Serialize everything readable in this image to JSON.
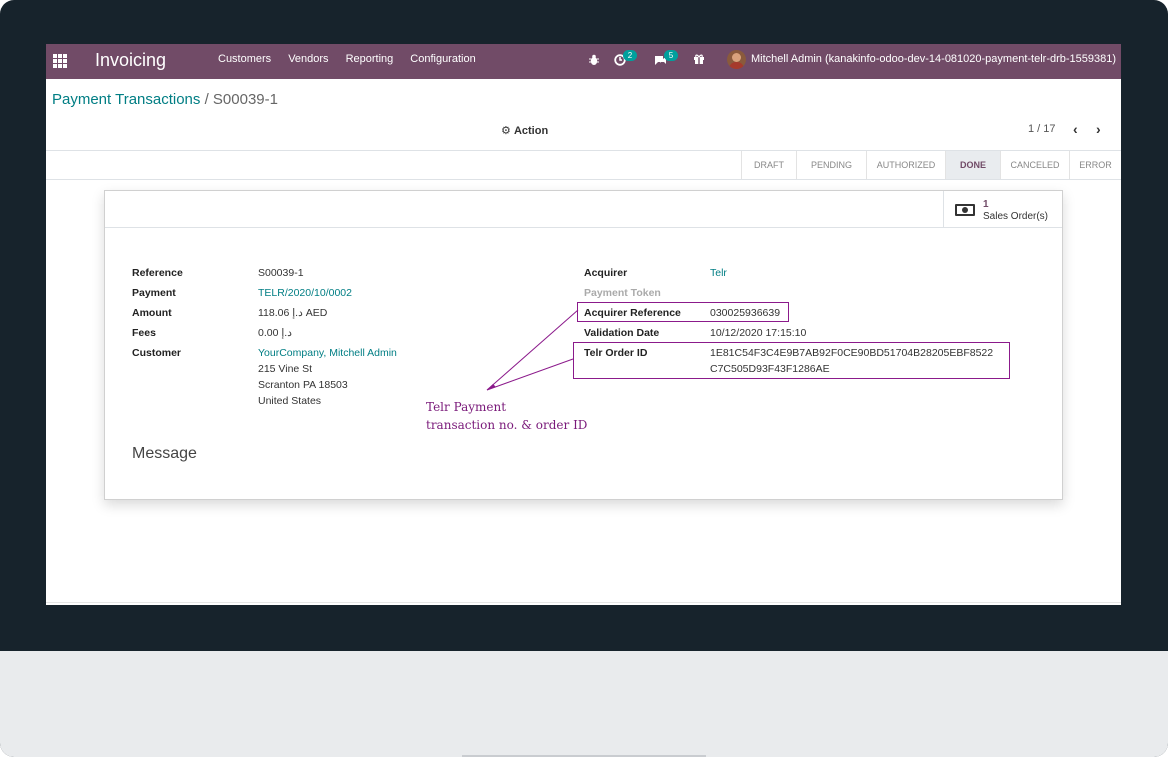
{
  "navbar": {
    "app_title": "Invoicing",
    "menu": [
      "Customers",
      "Vendors",
      "Reporting",
      "Configuration"
    ],
    "activity_count": "2",
    "messages_count": "5",
    "user": "Mitchell Admin (kanakinfo-odoo-dev-14-081020-payment-telr-drb-1559381)"
  },
  "breadcrumb": {
    "parent": "Payment Transactions",
    "separator": "/",
    "current": "S00039-1"
  },
  "control": {
    "action_label": "Action",
    "pager": "1 / 17"
  },
  "statusbar": {
    "states": [
      "DRAFT",
      "PENDING",
      "AUTHORIZED",
      "DONE",
      "CANCELED",
      "ERROR"
    ],
    "active": "DONE"
  },
  "smart_button": {
    "count": "1",
    "label": "Sales Order(s)"
  },
  "left_fields": {
    "reference": {
      "label": "Reference",
      "value": "S00039-1"
    },
    "payment": {
      "label": "Payment",
      "value": "TELR/2020/10/0002"
    },
    "amount": {
      "label": "Amount",
      "value": "118.06 د.إ AED"
    },
    "fees": {
      "label": "Fees",
      "value": "0.00 د.إ"
    },
    "customer": {
      "label": "Customer",
      "name": "YourCompany, Mitchell Admin",
      "street": "215 Vine St",
      "city": "Scranton PA 18503",
      "country": "United States"
    }
  },
  "right_fields": {
    "acquirer": {
      "label": "Acquirer",
      "value": "Telr"
    },
    "payment_token": {
      "label": "Payment Token"
    },
    "acquirer_reference": {
      "label": "Acquirer Reference",
      "value": "030025936639"
    },
    "validation_date": {
      "label": "Validation Date",
      "value": "10/12/2020 17:15:10"
    },
    "telr_order_id": {
      "label": "Telr Order ID",
      "value_line1": "1E81C54F3C4E9B7AB92F0CE90BD51704B28205EBF8522",
      "value_line2": "C7C505D93F43F1286AE"
    }
  },
  "message_section": "Message",
  "annotation": {
    "line1": "Telr Payment",
    "line2": "transaction no. & order ID",
    "color": "#7a1a7a"
  },
  "colors": {
    "brand": "#714b67",
    "link": "#017e84",
    "badge": "#00a09d"
  }
}
